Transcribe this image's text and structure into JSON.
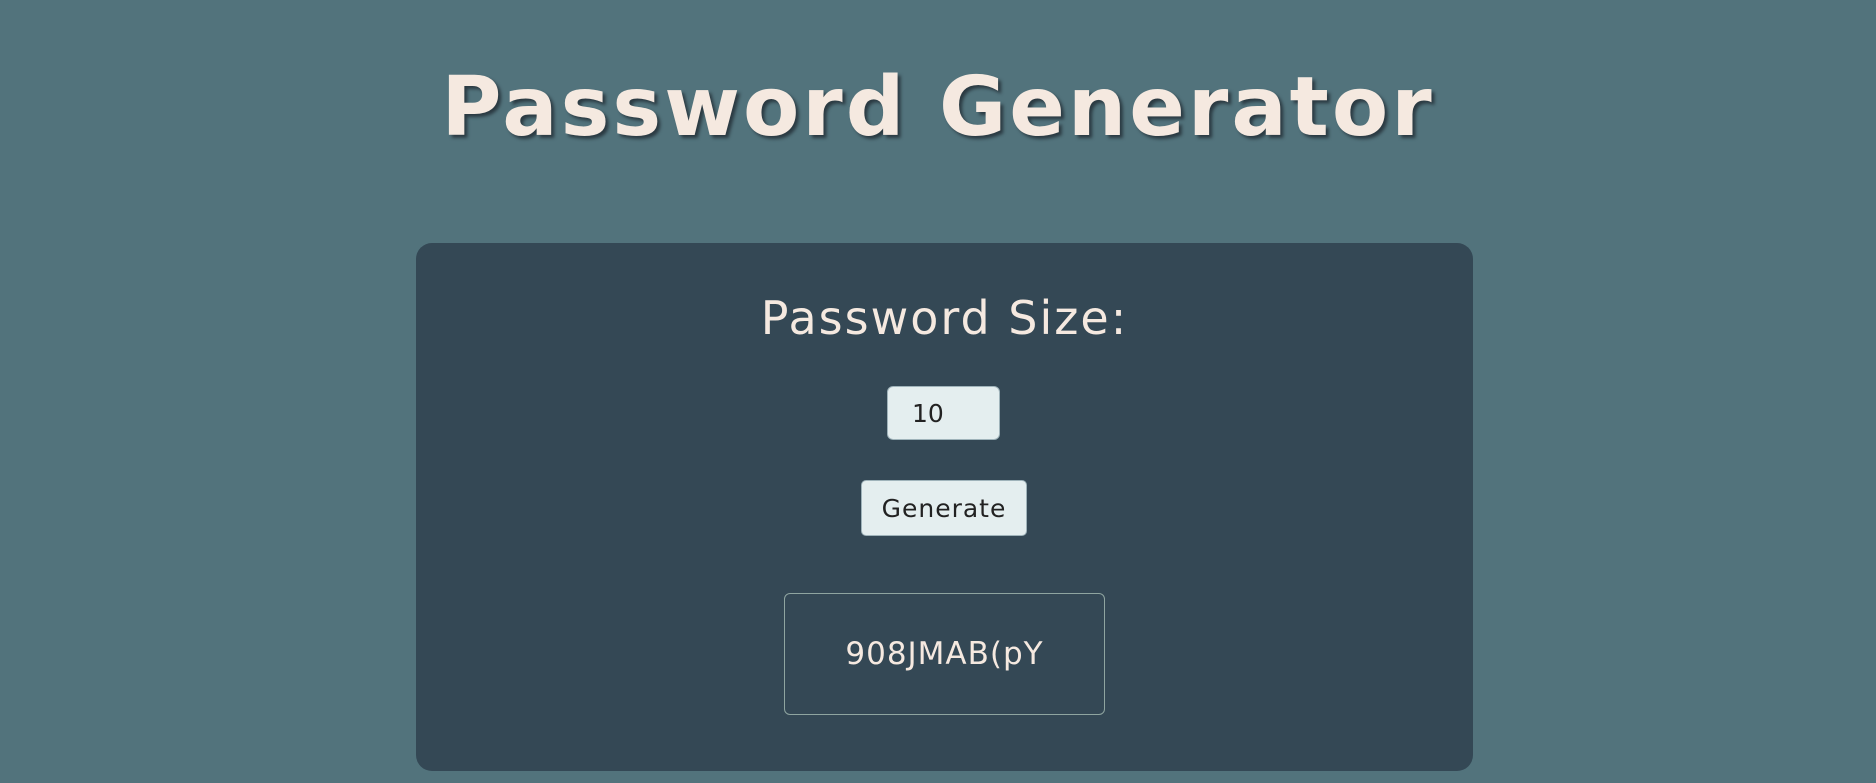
{
  "header": {
    "title": "Password Generator"
  },
  "generator": {
    "size_label": "Password Size:",
    "size_value": "10",
    "generate_label": "Generate",
    "result": "908JMAB(pY"
  },
  "colors": {
    "page_background": "#52737c",
    "card_background": "#344855",
    "text_light": "#f5e9e0",
    "input_background": "#e4eeef"
  }
}
